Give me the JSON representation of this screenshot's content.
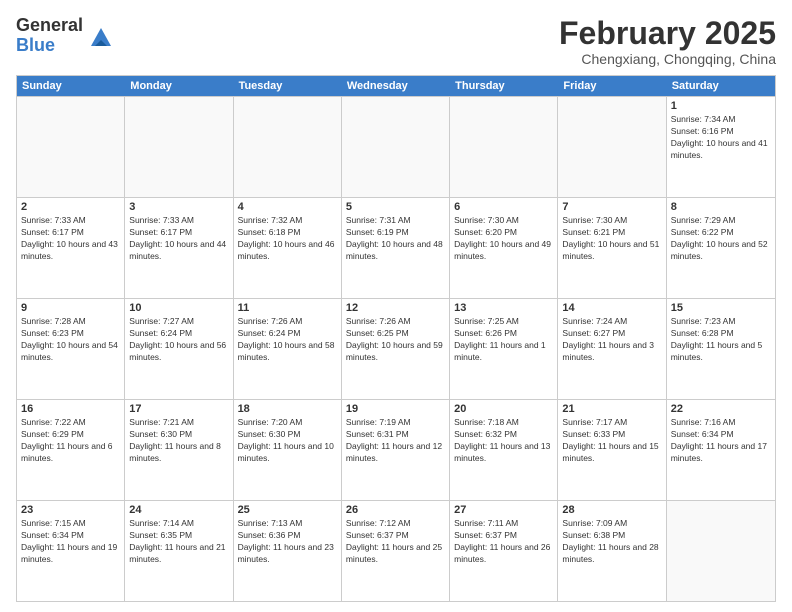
{
  "header": {
    "logo_general": "General",
    "logo_blue": "Blue",
    "month_year": "February 2025",
    "location": "Chengxiang, Chongqing, China"
  },
  "weekdays": [
    "Sunday",
    "Monday",
    "Tuesday",
    "Wednesday",
    "Thursday",
    "Friday",
    "Saturday"
  ],
  "weeks": [
    [
      {
        "day": "",
        "info": ""
      },
      {
        "day": "",
        "info": ""
      },
      {
        "day": "",
        "info": ""
      },
      {
        "day": "",
        "info": ""
      },
      {
        "day": "",
        "info": ""
      },
      {
        "day": "",
        "info": ""
      },
      {
        "day": "1",
        "info": "Sunrise: 7:34 AM\nSunset: 6:16 PM\nDaylight: 10 hours and 41 minutes."
      }
    ],
    [
      {
        "day": "2",
        "info": "Sunrise: 7:33 AM\nSunset: 6:17 PM\nDaylight: 10 hours and 43 minutes."
      },
      {
        "day": "3",
        "info": "Sunrise: 7:33 AM\nSunset: 6:17 PM\nDaylight: 10 hours and 44 minutes."
      },
      {
        "day": "4",
        "info": "Sunrise: 7:32 AM\nSunset: 6:18 PM\nDaylight: 10 hours and 46 minutes."
      },
      {
        "day": "5",
        "info": "Sunrise: 7:31 AM\nSunset: 6:19 PM\nDaylight: 10 hours and 48 minutes."
      },
      {
        "day": "6",
        "info": "Sunrise: 7:30 AM\nSunset: 6:20 PM\nDaylight: 10 hours and 49 minutes."
      },
      {
        "day": "7",
        "info": "Sunrise: 7:30 AM\nSunset: 6:21 PM\nDaylight: 10 hours and 51 minutes."
      },
      {
        "day": "8",
        "info": "Sunrise: 7:29 AM\nSunset: 6:22 PM\nDaylight: 10 hours and 52 minutes."
      }
    ],
    [
      {
        "day": "9",
        "info": "Sunrise: 7:28 AM\nSunset: 6:23 PM\nDaylight: 10 hours and 54 minutes."
      },
      {
        "day": "10",
        "info": "Sunrise: 7:27 AM\nSunset: 6:24 PM\nDaylight: 10 hours and 56 minutes."
      },
      {
        "day": "11",
        "info": "Sunrise: 7:26 AM\nSunset: 6:24 PM\nDaylight: 10 hours and 58 minutes."
      },
      {
        "day": "12",
        "info": "Sunrise: 7:26 AM\nSunset: 6:25 PM\nDaylight: 10 hours and 59 minutes."
      },
      {
        "day": "13",
        "info": "Sunrise: 7:25 AM\nSunset: 6:26 PM\nDaylight: 11 hours and 1 minute."
      },
      {
        "day": "14",
        "info": "Sunrise: 7:24 AM\nSunset: 6:27 PM\nDaylight: 11 hours and 3 minutes."
      },
      {
        "day": "15",
        "info": "Sunrise: 7:23 AM\nSunset: 6:28 PM\nDaylight: 11 hours and 5 minutes."
      }
    ],
    [
      {
        "day": "16",
        "info": "Sunrise: 7:22 AM\nSunset: 6:29 PM\nDaylight: 11 hours and 6 minutes."
      },
      {
        "day": "17",
        "info": "Sunrise: 7:21 AM\nSunset: 6:30 PM\nDaylight: 11 hours and 8 minutes."
      },
      {
        "day": "18",
        "info": "Sunrise: 7:20 AM\nSunset: 6:30 PM\nDaylight: 11 hours and 10 minutes."
      },
      {
        "day": "19",
        "info": "Sunrise: 7:19 AM\nSunset: 6:31 PM\nDaylight: 11 hours and 12 minutes."
      },
      {
        "day": "20",
        "info": "Sunrise: 7:18 AM\nSunset: 6:32 PM\nDaylight: 11 hours and 13 minutes."
      },
      {
        "day": "21",
        "info": "Sunrise: 7:17 AM\nSunset: 6:33 PM\nDaylight: 11 hours and 15 minutes."
      },
      {
        "day": "22",
        "info": "Sunrise: 7:16 AM\nSunset: 6:34 PM\nDaylight: 11 hours and 17 minutes."
      }
    ],
    [
      {
        "day": "23",
        "info": "Sunrise: 7:15 AM\nSunset: 6:34 PM\nDaylight: 11 hours and 19 minutes."
      },
      {
        "day": "24",
        "info": "Sunrise: 7:14 AM\nSunset: 6:35 PM\nDaylight: 11 hours and 21 minutes."
      },
      {
        "day": "25",
        "info": "Sunrise: 7:13 AM\nSunset: 6:36 PM\nDaylight: 11 hours and 23 minutes."
      },
      {
        "day": "26",
        "info": "Sunrise: 7:12 AM\nSunset: 6:37 PM\nDaylight: 11 hours and 25 minutes."
      },
      {
        "day": "27",
        "info": "Sunrise: 7:11 AM\nSunset: 6:37 PM\nDaylight: 11 hours and 26 minutes."
      },
      {
        "day": "28",
        "info": "Sunrise: 7:09 AM\nSunset: 6:38 PM\nDaylight: 11 hours and 28 minutes."
      },
      {
        "day": "",
        "info": ""
      }
    ]
  ]
}
